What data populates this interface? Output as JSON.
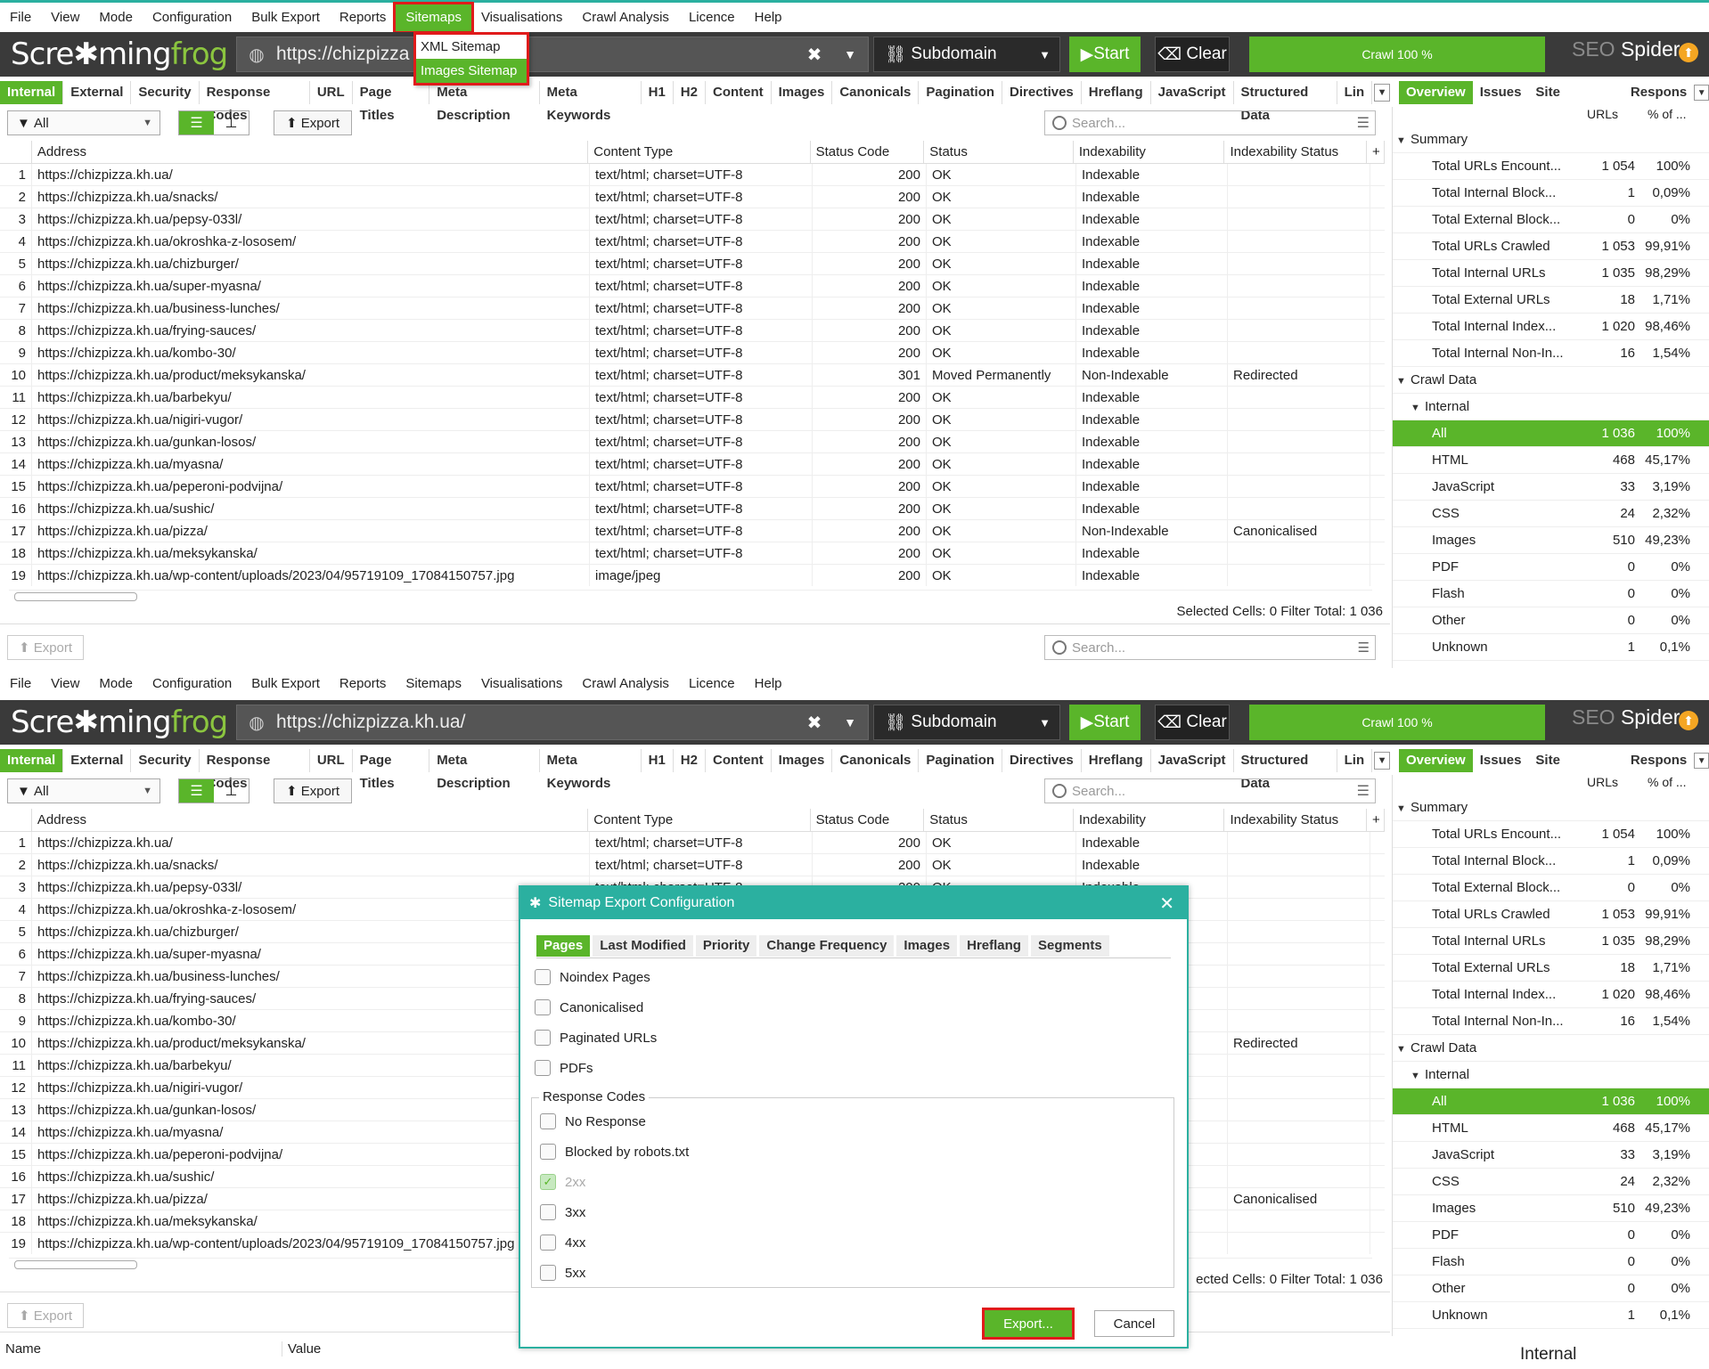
{
  "menu": [
    "File",
    "View",
    "Mode",
    "Configuration",
    "Bulk Export",
    "Reports",
    "Sitemaps",
    "Visualisations",
    "Crawl Analysis",
    "Licence",
    "Help"
  ],
  "logo": {
    "text1": "Scre",
    "text2": "ming",
    "text3": "frog"
  },
  "url": "https://chizpizza.kh.ua/",
  "url_truncated": "https://chizpizza",
  "scope": "Subdomain",
  "start_label": "Start",
  "clear_label": "Clear",
  "progress": {
    "label": "Crawl 100 %",
    "value": 1.0
  },
  "brand": {
    "seo": "SEO",
    "spider": "Spider"
  },
  "tabs": [
    "Internal",
    "External",
    "Security",
    "Response Codes",
    "URL",
    "Page Titles",
    "Meta Description",
    "Meta Keywords",
    "H1",
    "H2",
    "Content",
    "Images",
    "Canonicals",
    "Pagination",
    "Directives",
    "Hreflang",
    "JavaScript",
    "Structured Data",
    "Lin"
  ],
  "right_tabs": [
    "Overview",
    "Issues",
    "Site Structure",
    "Respons"
  ],
  "filter": {
    "value": "All"
  },
  "export_label": "Export",
  "search_placeholder": "Search...",
  "columns": [
    "Address",
    "Content Type",
    "Status Code",
    "Status",
    "Indexability",
    "Indexability Status"
  ],
  "rows": [
    [
      "1",
      "https://chizpizza.kh.ua/",
      "text/html; charset=UTF-8",
      "200",
      "OK",
      "Indexable",
      ""
    ],
    [
      "2",
      "https://chizpizza.kh.ua/snacks/",
      "text/html; charset=UTF-8",
      "200",
      "OK",
      "Indexable",
      ""
    ],
    [
      "3",
      "https://chizpizza.kh.ua/pepsy-033l/",
      "text/html; charset=UTF-8",
      "200",
      "OK",
      "Indexable",
      ""
    ],
    [
      "4",
      "https://chizpizza.kh.ua/okroshka-z-lososem/",
      "text/html; charset=UTF-8",
      "200",
      "OK",
      "Indexable",
      ""
    ],
    [
      "5",
      "https://chizpizza.kh.ua/chizburger/",
      "text/html; charset=UTF-8",
      "200",
      "OK",
      "Indexable",
      ""
    ],
    [
      "6",
      "https://chizpizza.kh.ua/super-myasna/",
      "text/html; charset=UTF-8",
      "200",
      "OK",
      "Indexable",
      ""
    ],
    [
      "7",
      "https://chizpizza.kh.ua/business-lunches/",
      "text/html; charset=UTF-8",
      "200",
      "OK",
      "Indexable",
      ""
    ],
    [
      "8",
      "https://chizpizza.kh.ua/frying-sauces/",
      "text/html; charset=UTF-8",
      "200",
      "OK",
      "Indexable",
      ""
    ],
    [
      "9",
      "https://chizpizza.kh.ua/kombo-30/",
      "text/html; charset=UTF-8",
      "200",
      "OK",
      "Indexable",
      ""
    ],
    [
      "10",
      "https://chizpizza.kh.ua/product/meksykanska/",
      "text/html; charset=UTF-8",
      "301",
      "Moved Permanently",
      "Non-Indexable",
      "Redirected"
    ],
    [
      "11",
      "https://chizpizza.kh.ua/barbekyu/",
      "text/html; charset=UTF-8",
      "200",
      "OK",
      "Indexable",
      ""
    ],
    [
      "12",
      "https://chizpizza.kh.ua/nigiri-vugor/",
      "text/html; charset=UTF-8",
      "200",
      "OK",
      "Indexable",
      ""
    ],
    [
      "13",
      "https://chizpizza.kh.ua/gunkan-losos/",
      "text/html; charset=UTF-8",
      "200",
      "OK",
      "Indexable",
      ""
    ],
    [
      "14",
      "https://chizpizza.kh.ua/myasna/",
      "text/html; charset=UTF-8",
      "200",
      "OK",
      "Indexable",
      ""
    ],
    [
      "15",
      "https://chizpizza.kh.ua/peperoni-podvijna/",
      "text/html; charset=UTF-8",
      "200",
      "OK",
      "Indexable",
      ""
    ],
    [
      "16",
      "https://chizpizza.kh.ua/sushic/",
      "text/html; charset=UTF-8",
      "200",
      "OK",
      "Indexable",
      ""
    ],
    [
      "17",
      "https://chizpizza.kh.ua/pizza/",
      "text/html; charset=UTF-8",
      "200",
      "OK",
      "Non-Indexable",
      "Canonicalised"
    ],
    [
      "18",
      "https://chizpizza.kh.ua/meksykanska/",
      "text/html; charset=UTF-8",
      "200",
      "OK",
      "Indexable",
      ""
    ],
    [
      "19",
      "https://chizpizza.kh.ua/wp-content/uploads/2023/04/95719109_17084150757.jpg",
      "image/jpeg",
      "200",
      "OK",
      "Indexable",
      ""
    ]
  ],
  "status_line": "Selected Cells:  0  Filter Total:  1 036",
  "status_line_b": "ected Cells:  0  Filter Total:  1 036",
  "side_header": {
    "urls": "URLs",
    "pct": "% of ..."
  },
  "side": [
    {
      "label": "Summary",
      "type": "group",
      "n": "",
      "p": ""
    },
    {
      "label": "Total URLs Encount...",
      "n": "1 054",
      "p": "100%"
    },
    {
      "label": "Total Internal Block...",
      "n": "1",
      "p": "0,09%"
    },
    {
      "label": "Total External Block...",
      "n": "0",
      "p": "0%"
    },
    {
      "label": "Total URLs Crawled",
      "n": "1 053",
      "p": "99,91%"
    },
    {
      "label": "Total Internal URLs",
      "n": "1 035",
      "p": "98,29%"
    },
    {
      "label": "Total External URLs",
      "n": "18",
      "p": "1,71%"
    },
    {
      "label": "Total Internal Index...",
      "n": "1 020",
      "p": "98,46%"
    },
    {
      "label": "Total Internal Non-In...",
      "n": "16",
      "p": "1,54%"
    },
    {
      "label": "Crawl Data",
      "type": "group",
      "n": "",
      "p": ""
    },
    {
      "label": "Internal",
      "type": "sub",
      "n": "",
      "p": ""
    },
    {
      "label": "All",
      "type": "selected",
      "n": "1 036",
      "p": "100%"
    },
    {
      "label": "HTML",
      "n": "468",
      "p": "45,17%"
    },
    {
      "label": "JavaScript",
      "n": "33",
      "p": "3,19%"
    },
    {
      "label": "CSS",
      "n": "24",
      "p": "2,32%"
    },
    {
      "label": "Images",
      "n": "510",
      "p": "49,23%"
    },
    {
      "label": "PDF",
      "n": "0",
      "p": "0%"
    },
    {
      "label": "Flash",
      "n": "0",
      "p": "0%"
    },
    {
      "label": "Other",
      "n": "0",
      "p": "0%"
    },
    {
      "label": "Unknown",
      "n": "1",
      "p": "0,1%"
    }
  ],
  "sitemap_menu": [
    "XML Sitemap",
    "Images Sitemap"
  ],
  "dialog": {
    "title": "Sitemap Export Configuration",
    "tabs": [
      "Pages",
      "Last Modified",
      "Priority",
      "Change Frequency",
      "Images",
      "Hreflang",
      "Segments"
    ],
    "options": [
      "Noindex Pages",
      "Canonicalised",
      "Paginated URLs",
      "PDFs"
    ],
    "group_label": "Response Codes",
    "codes": [
      "No Response",
      "Blocked by robots.txt",
      "2xx",
      "3xx",
      "4xx",
      "5xx"
    ],
    "export_label": "Export...",
    "cancel_label": "Cancel"
  },
  "bottom_panel": {
    "name": "Name",
    "value": "Value"
  },
  "internal_label": "Internal"
}
